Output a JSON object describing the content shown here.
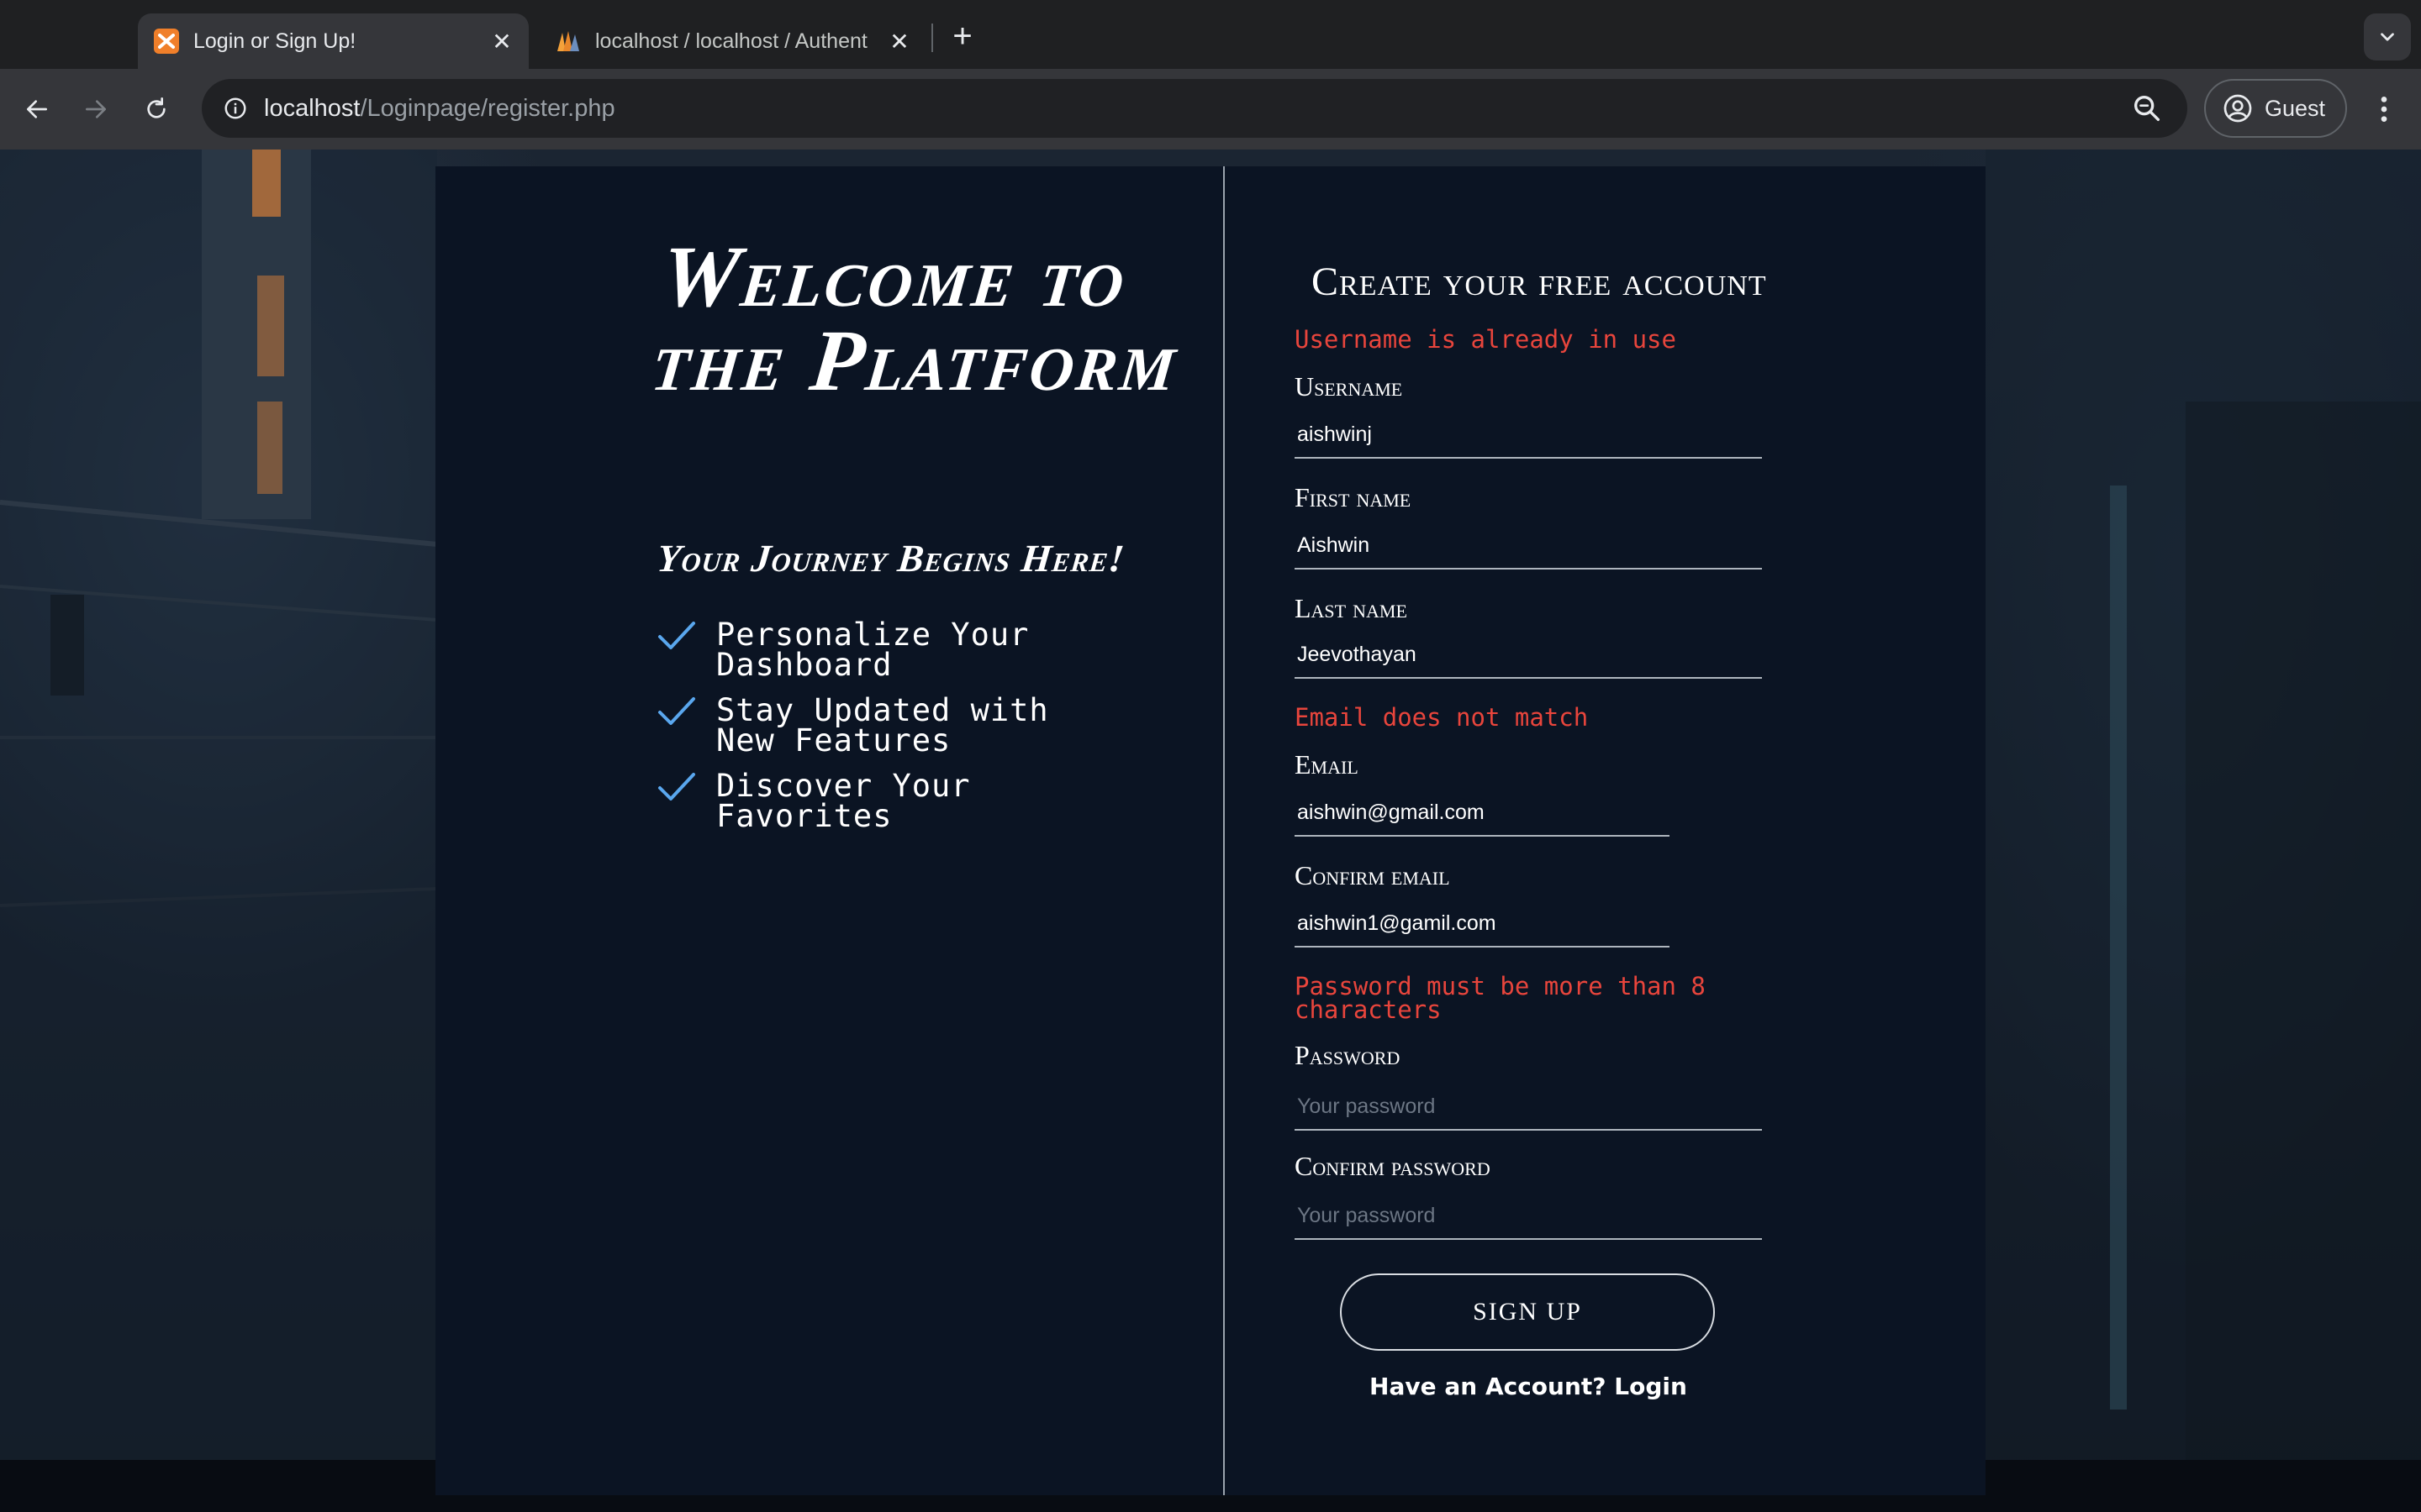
{
  "browser": {
    "tabs": [
      {
        "title": "Login or Sign Up!",
        "favicon": "xampp-icon",
        "active": true
      },
      {
        "title": "localhost / localhost / Authent",
        "favicon": "phpmyadmin-icon",
        "active": false
      }
    ],
    "url_host": "localhost",
    "url_path": "/Loginpage/register.php",
    "profile_label": "Guest"
  },
  "left": {
    "welcome_heading": "Welcome to the Platform",
    "tagline": "Your Journey Begins Here!",
    "features": [
      "Personalize Your Dashboard",
      "Stay Updated with New Features",
      "Discover Your Favorites"
    ]
  },
  "form": {
    "title": "Create your free account",
    "errors": {
      "username": "Username is already in use",
      "email": "Email does not match",
      "password": "Password must be more than 8 characters"
    },
    "username": {
      "label": "Username",
      "value": "aishwinj"
    },
    "first_name": {
      "label": "First name",
      "value": "Aishwin"
    },
    "last_name": {
      "label": "Last name",
      "value": "Jeevothayan"
    },
    "email": {
      "label": "Email",
      "value": "aishwin@gmail.com"
    },
    "confirm_email": {
      "label": "Confirm email",
      "value": "aishwin1@gamil.com"
    },
    "password": {
      "label": "Password",
      "placeholder": "Your password",
      "value": ""
    },
    "confirm_password": {
      "label": "Confirm password",
      "placeholder": "Your password",
      "value": ""
    },
    "signup_label": "SIGN UP",
    "login_link": "Have an Account? Login"
  },
  "colors": {
    "error": "#e8453c",
    "card_background": "#0b1423",
    "check_accent": "#5aa7ee"
  }
}
